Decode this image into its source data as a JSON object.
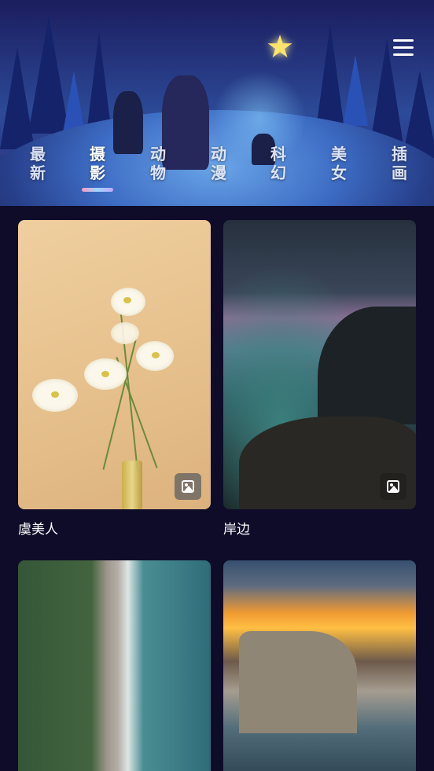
{
  "header": {
    "star_icon": "star-icon",
    "menu_icon": "hamburger-menu-icon"
  },
  "tabs": [
    {
      "label": "最新",
      "active": false
    },
    {
      "label": "摄影",
      "active": true
    },
    {
      "label": "动物",
      "active": false
    },
    {
      "label": "动漫",
      "active": false
    },
    {
      "label": "科幻",
      "active": false
    },
    {
      "label": "美女",
      "active": false
    },
    {
      "label": "插画",
      "active": false
    }
  ],
  "cards": [
    {
      "title": "虞美人",
      "badge_icon": "image-icon"
    },
    {
      "title": "岸边",
      "badge_icon": "image-icon"
    },
    {
      "title": "",
      "badge_icon": ""
    },
    {
      "title": "",
      "badge_icon": ""
    }
  ],
  "colors": {
    "background": "#0f0c2a",
    "header_top": "#1b1d5e",
    "indicator_start": "#f59cc7",
    "indicator_end": "#c6a8ff",
    "text": "#ffffff"
  }
}
